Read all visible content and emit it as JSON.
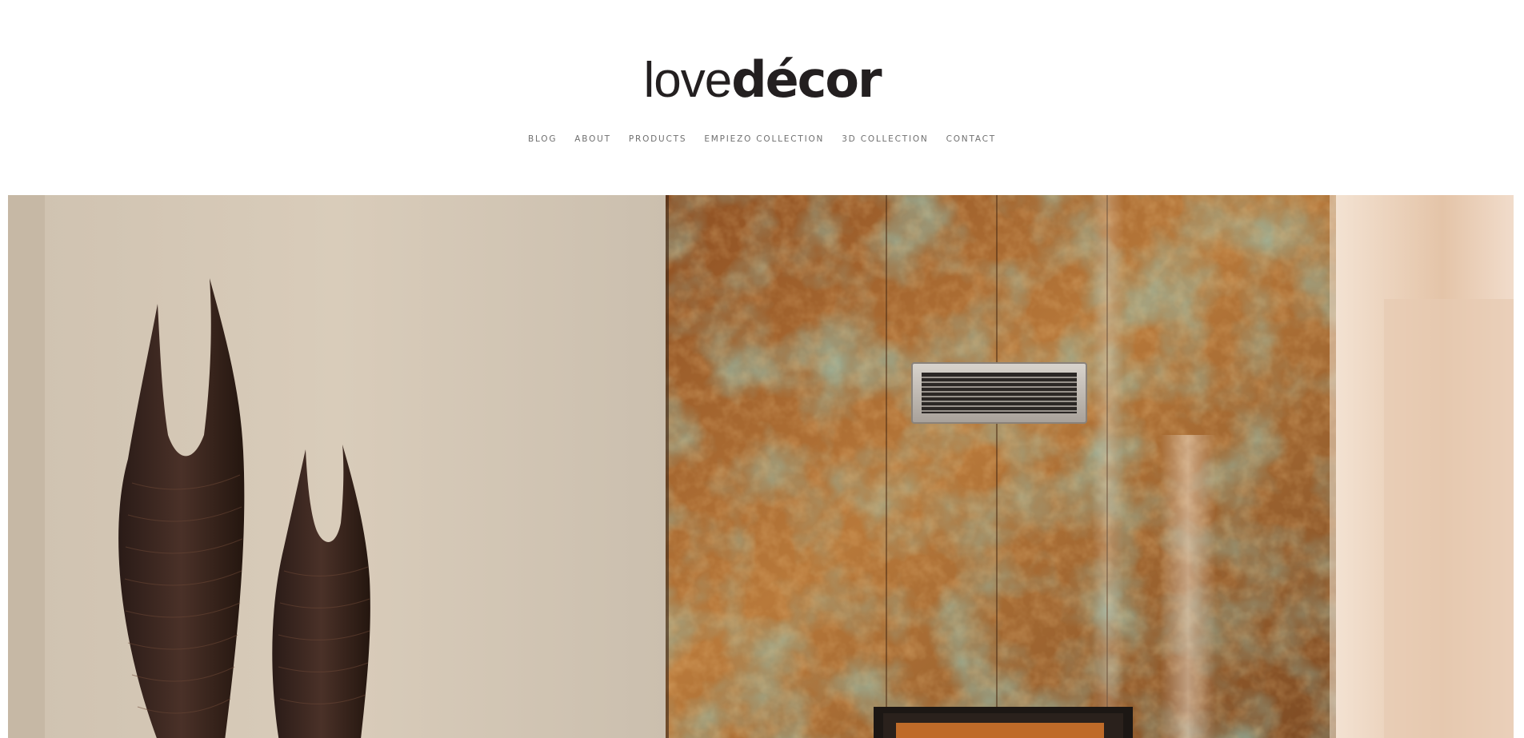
{
  "brand": {
    "logo_light": "love",
    "logo_bold": "décor"
  },
  "nav": {
    "items": [
      {
        "label": "BLOG"
      },
      {
        "label": "ABOUT"
      },
      {
        "label": "PRODUCTS"
      },
      {
        "label": "EMPIEZO COLLECTION"
      },
      {
        "label": "3D COLLECTION"
      },
      {
        "label": "CONTACT"
      }
    ]
  },
  "hero": {
    "colors": {
      "wall": "#d8ccbb",
      "copper": "#a8682e",
      "verdigris": "#4f8f7a",
      "sculpture": "#3b2a24"
    }
  }
}
